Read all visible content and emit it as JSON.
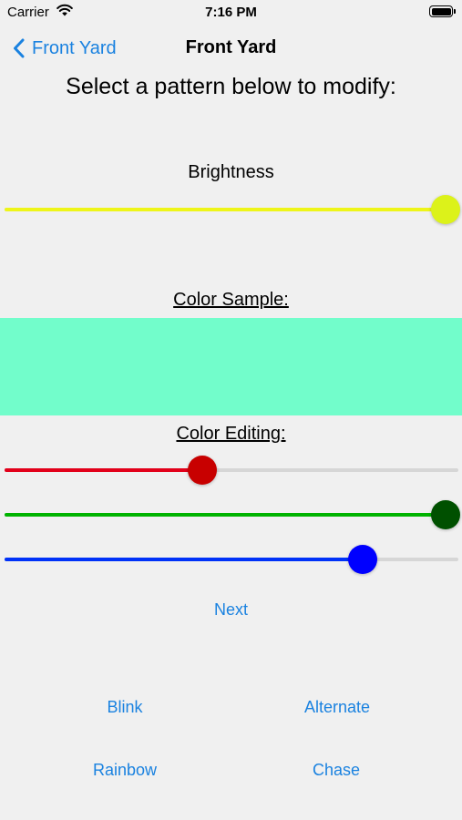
{
  "status_bar": {
    "carrier": "Carrier",
    "time": "7:16 PM"
  },
  "nav": {
    "back_label": "Front Yard",
    "title": "Front Yard"
  },
  "prompt": "Select a pattern below to modify:",
  "brightness": {
    "label": "Brightness",
    "value": 1.0,
    "color": "#eef519",
    "thumb_color": "#dcf21a"
  },
  "color_sample": {
    "label": "Color Sample:",
    "color": "#72fdcb"
  },
  "color_editing": {
    "label": "Color Editing:",
    "red": {
      "value": 0.435,
      "color": "#e2001a",
      "thumb_color": "#c80000"
    },
    "green": {
      "value": 1.0,
      "color": "#00b300",
      "thumb_color": "#005000"
    },
    "blue": {
      "value": 0.79,
      "color": "#0032f8",
      "thumb_color": "#0000ff"
    }
  },
  "next_label": "Next",
  "patterns": {
    "blink": "Blink",
    "alternate": "Alternate",
    "rainbow": "Rainbow",
    "chase": "Chase"
  },
  "accent_color": "#1a82e0",
  "icons": {
    "back": "chevron-left-icon",
    "wifi": "wifi-icon",
    "battery": "battery-icon"
  }
}
